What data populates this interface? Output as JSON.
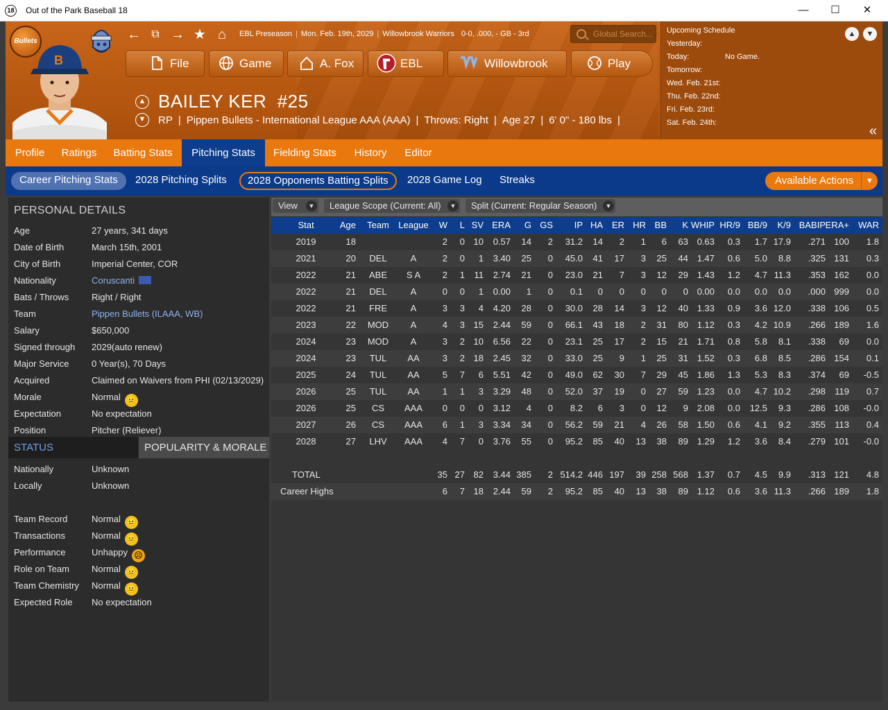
{
  "window": {
    "icon_text": "18",
    "title": "Out of the Park Baseball 18",
    "min": "—",
    "max": "☐",
    "close": "✕"
  },
  "header": {
    "breadcrumb": {
      "league": "EBL Preseason",
      "date": "Mon. Feb. 19th, 2029",
      "team": "Willowbrook Warriors",
      "record": "0-0, .000, - GB - 3rd"
    },
    "search_placeholder": "Global Search...",
    "team_logo_text": "Bullets",
    "menu": [
      {
        "label": "File",
        "icon": "file-icon"
      },
      {
        "label": "Game",
        "icon": "globe-icon"
      },
      {
        "label": "A. Fox",
        "icon": "home-icon"
      },
      {
        "label": "EBL",
        "icon": "ebl-logo-icon"
      },
      {
        "label": "Willowbrook",
        "icon": "willowbrook-logo-icon"
      },
      {
        "label": "Play",
        "icon": "baseball-icon"
      }
    ],
    "player": {
      "name": "BAILEY KER",
      "number": "#25",
      "position": "RP",
      "team_league": "Pippen Bullets - International League AAA (AAA)",
      "throws": "Throws: Right",
      "age": "Age 27",
      "size": "6' 0\" - 180 lbs"
    }
  },
  "schedule": {
    "title": "Upcoming Schedule",
    "rows": [
      {
        "label": "Yesterday:",
        "value": ""
      },
      {
        "label": "Today:",
        "value": "No Game."
      },
      {
        "label": "Tomorrow:",
        "value": ""
      },
      {
        "label": "Wed. Feb. 21st:",
        "value": ""
      },
      {
        "label": "Thu. Feb. 22nd:",
        "value": ""
      },
      {
        "label": "Fri. Feb. 23rd:",
        "value": ""
      },
      {
        "label": "Sat. Feb. 24th:",
        "value": ""
      }
    ]
  },
  "tabs": [
    "Profile",
    "Ratings",
    "Batting Stats",
    "Pitching Stats",
    "Fielding Stats",
    "History",
    "Editor"
  ],
  "active_tab": "Pitching Stats",
  "subtabs": [
    "Career Pitching Stats",
    "2028 Pitching Splits",
    "2028 Opponents Batting Splits",
    "2028 Game Log",
    "Streaks"
  ],
  "available_actions": "Available Actions",
  "personal": {
    "title": "PERSONAL DETAILS",
    "rows": [
      {
        "k": "Age",
        "v": "27 years, 341 days"
      },
      {
        "k": "Date of Birth",
        "v": "March 15th, 2001"
      },
      {
        "k": "City of Birth",
        "v": "Imperial Center, COR"
      },
      {
        "k": "Nationality",
        "v": "Coruscanti",
        "link": true,
        "flag": true
      },
      {
        "k": "Bats / Throws",
        "v": "Right / Right"
      },
      {
        "k": "Team",
        "v": "Pippen Bullets (ILAAA, WB)",
        "link": true
      },
      {
        "k": "Salary",
        "v": "$650,000"
      },
      {
        "k": "Signed through",
        "v": "2029(auto renew)"
      },
      {
        "k": "Major Service",
        "v": "0 Year(s), 70 Days"
      },
      {
        "k": "Acquired",
        "v": "Claimed on Waivers from PHI (02/13/2029)"
      },
      {
        "k": "Morale",
        "v": "Normal",
        "mood": "neutral"
      },
      {
        "k": "Expectation",
        "v": "No expectation"
      },
      {
        "k": "Position",
        "v": "Pitcher (Reliever)"
      }
    ]
  },
  "status": {
    "tab_status": "STATUS",
    "tab_pop": "POPULARITY & MORALE",
    "rows": [
      {
        "k": "Nationally",
        "v": "Unknown"
      },
      {
        "k": "Locally",
        "v": "Unknown"
      },
      {
        "k": "",
        "v": ""
      },
      {
        "k": "Team Record",
        "v": "Normal",
        "mood": "neutral"
      },
      {
        "k": "Transactions",
        "v": "Normal",
        "mood": "neutral"
      },
      {
        "k": "Performance",
        "v": "Unhappy",
        "mood": "sad"
      },
      {
        "k": "Role on Team",
        "v": "Normal",
        "mood": "neutral"
      },
      {
        "k": "Team Chemistry",
        "v": "Normal",
        "mood": "neutral"
      },
      {
        "k": "Expected Role",
        "v": "No expectation"
      }
    ]
  },
  "filters": {
    "view": "View",
    "scope": "League Scope  (Current: All)",
    "split": "Split  (Current: Regular Season)"
  },
  "table": {
    "columns": [
      "Stat",
      "Age",
      "Team",
      "League",
      "W",
      "L",
      "SV",
      "ERA",
      "G",
      "GS",
      "IP",
      "HA",
      "ER",
      "HR",
      "BB",
      "K",
      "WHIP",
      "HR/9",
      "BB/9",
      "K/9",
      "BABIP",
      "ERA+",
      "WAR"
    ],
    "rows": [
      [
        "2019",
        "18",
        "",
        "",
        "2",
        "0",
        "10",
        "0.57",
        "14",
        "2",
        "31.2",
        "14",
        "2",
        "1",
        "6",
        "63",
        "0.63",
        "0.3",
        "1.7",
        "17.9",
        ".271",
        "100",
        "1.8"
      ],
      [
        "2021",
        "20",
        "DEL",
        "A",
        "2",
        "0",
        "1",
        "3.40",
        "25",
        "0",
        "45.0",
        "41",
        "17",
        "3",
        "25",
        "44",
        "1.47",
        "0.6",
        "5.0",
        "8.8",
        ".325",
        "131",
        "0.3"
      ],
      [
        "2022",
        "21",
        "ABE",
        "S A",
        "2",
        "1",
        "11",
        "2.74",
        "21",
        "0",
        "23.0",
        "21",
        "7",
        "3",
        "12",
        "29",
        "1.43",
        "1.2",
        "4.7",
        "11.3",
        ".353",
        "162",
        "0.0"
      ],
      [
        "2022",
        "21",
        "DEL",
        "A",
        "0",
        "0",
        "1",
        "0.00",
        "1",
        "0",
        "0.1",
        "0",
        "0",
        "0",
        "0",
        "0",
        "0.00",
        "0.0",
        "0.0",
        "0.0",
        ".000",
        "999",
        "0.0"
      ],
      [
        "2022",
        "21",
        "FRE",
        "A",
        "3",
        "3",
        "4",
        "4.20",
        "28",
        "0",
        "30.0",
        "28",
        "14",
        "3",
        "12",
        "40",
        "1.33",
        "0.9",
        "3.6",
        "12.0",
        ".338",
        "106",
        "0.5"
      ],
      [
        "2023",
        "22",
        "MOD",
        "A",
        "4",
        "3",
        "15",
        "2.44",
        "59",
        "0",
        "66.1",
        "43",
        "18",
        "2",
        "31",
        "80",
        "1.12",
        "0.3",
        "4.2",
        "10.9",
        ".266",
        "189",
        "1.6"
      ],
      [
        "2024",
        "23",
        "MOD",
        "A",
        "3",
        "2",
        "10",
        "6.56",
        "22",
        "0",
        "23.1",
        "25",
        "17",
        "2",
        "15",
        "21",
        "1.71",
        "0.8",
        "5.8",
        "8.1",
        ".338",
        "69",
        "0.0"
      ],
      [
        "2024",
        "23",
        "TUL",
        "AA",
        "3",
        "2",
        "18",
        "2.45",
        "32",
        "0",
        "33.0",
        "25",
        "9",
        "1",
        "25",
        "31",
        "1.52",
        "0.3",
        "6.8",
        "8.5",
        ".286",
        "154",
        "0.1"
      ],
      [
        "2025",
        "24",
        "TUL",
        "AA",
        "5",
        "7",
        "6",
        "5.51",
        "42",
        "0",
        "49.0",
        "62",
        "30",
        "7",
        "29",
        "45",
        "1.86",
        "1.3",
        "5.3",
        "8.3",
        ".374",
        "69",
        "-0.5"
      ],
      [
        "2026",
        "25",
        "TUL",
        "AA",
        "1",
        "1",
        "3",
        "3.29",
        "48",
        "0",
        "52.0",
        "37",
        "19",
        "0",
        "27",
        "59",
        "1.23",
        "0.0",
        "4.7",
        "10.2",
        ".298",
        "119",
        "0.7"
      ],
      [
        "2026",
        "25",
        "CS",
        "AAA",
        "0",
        "0",
        "0",
        "3.12",
        "4",
        "0",
        "8.2",
        "6",
        "3",
        "0",
        "12",
        "9",
        "2.08",
        "0.0",
        "12.5",
        "9.3",
        ".286",
        "108",
        "-0.0"
      ],
      [
        "2027",
        "26",
        "CS",
        "AAA",
        "6",
        "1",
        "3",
        "3.34",
        "34",
        "0",
        "56.2",
        "59",
        "21",
        "4",
        "26",
        "58",
        "1.50",
        "0.6",
        "4.1",
        "9.2",
        ".355",
        "113",
        "0.4"
      ],
      [
        "2028",
        "27",
        "LHV",
        "AAA",
        "4",
        "7",
        "0",
        "3.76",
        "55",
        "0",
        "95.2",
        "85",
        "40",
        "13",
        "38",
        "89",
        "1.29",
        "1.2",
        "3.6",
        "8.4",
        ".279",
        "101",
        "-0.0"
      ]
    ],
    "total": [
      "TOTAL",
      "",
      "",
      "",
      "35",
      "27",
      "82",
      "3.44",
      "385",
      "2",
      "514.2",
      "446",
      "197",
      "39",
      "258",
      "568",
      "1.37",
      "0.7",
      "4.5",
      "9.9",
      ".313",
      "121",
      "4.8"
    ],
    "career_highs": [
      "Career Highs",
      "",
      "",
      "",
      "6",
      "7",
      "18",
      "2.44",
      "59",
      "2",
      "95.2",
      "85",
      "40",
      "13",
      "38",
      "89",
      "1.12",
      "0.6",
      "3.6",
      "11.3",
      ".266",
      "189",
      "1.8"
    ]
  },
  "colors": {
    "accent_orange": "#e9790f",
    "nav_blue": "#0d3d8c",
    "link_blue": "#8fb3ec"
  }
}
